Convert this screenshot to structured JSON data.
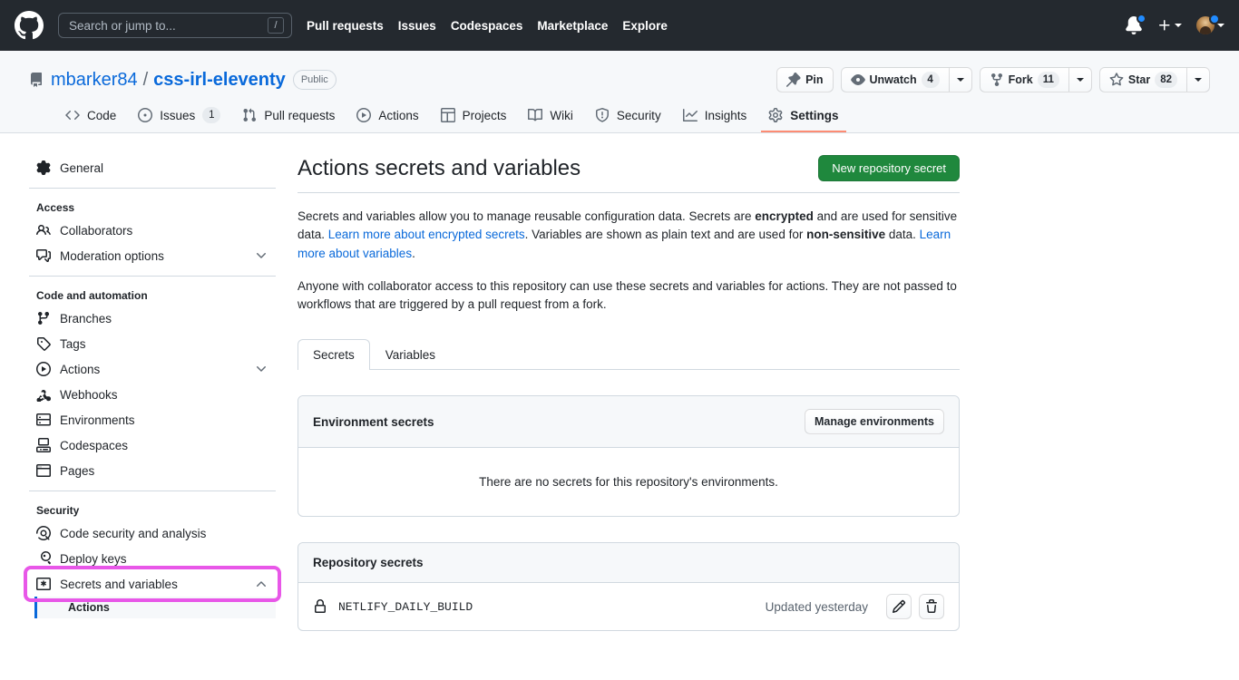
{
  "header": {
    "logo_icon": "github-mark-icon",
    "search": {
      "placeholder": "Search or jump to...",
      "shortcut": "/"
    },
    "nav": [
      {
        "label": "Pull requests"
      },
      {
        "label": "Issues"
      },
      {
        "label": "Codespaces"
      },
      {
        "label": "Marketplace"
      },
      {
        "label": "Explore"
      }
    ],
    "notifications_icon": "bell-icon",
    "create_new_icon": "plus-icon",
    "avatar_icon": "user-avatar"
  },
  "repo": {
    "icon": "repo-icon",
    "owner": "mbarker84",
    "separator": "/",
    "name": "css-irl-eleventy",
    "visibility": "Public",
    "actions": {
      "pin": {
        "label": "Pin",
        "icon": "pin-icon"
      },
      "watch": {
        "label": "Unwatch",
        "count": "4",
        "icon": "eye-icon"
      },
      "fork": {
        "label": "Fork",
        "count": "11",
        "icon": "fork-icon"
      },
      "star": {
        "label": "Star",
        "count": "82",
        "icon": "star-icon"
      }
    },
    "tabs": [
      {
        "label": "Code",
        "icon": "code-icon",
        "count": null,
        "active": false
      },
      {
        "label": "Issues",
        "icon": "issue-opened-icon",
        "count": "1",
        "active": false
      },
      {
        "label": "Pull requests",
        "icon": "git-pull-request-icon",
        "count": null,
        "active": false
      },
      {
        "label": "Actions",
        "icon": "play-icon",
        "count": null,
        "active": false
      },
      {
        "label": "Projects",
        "icon": "table-icon",
        "count": null,
        "active": false
      },
      {
        "label": "Wiki",
        "icon": "book-icon",
        "count": null,
        "active": false
      },
      {
        "label": "Security",
        "icon": "shield-icon",
        "count": null,
        "active": false
      },
      {
        "label": "Insights",
        "icon": "graph-icon",
        "count": null,
        "active": false
      },
      {
        "label": "Settings",
        "icon": "gear-icon",
        "count": null,
        "active": true
      }
    ]
  },
  "sidebar": {
    "general": {
      "label": "General",
      "icon": "gear-icon"
    },
    "sections": [
      {
        "title": "Access",
        "items": [
          {
            "label": "Collaborators",
            "icon": "people-icon",
            "expandable": false
          },
          {
            "label": "Moderation options",
            "icon": "comment-discussion-icon",
            "expandable": true,
            "expanded": false
          }
        ]
      },
      {
        "title": "Code and automation",
        "items": [
          {
            "label": "Branches",
            "icon": "git-branch-icon",
            "expandable": false
          },
          {
            "label": "Tags",
            "icon": "tag-icon",
            "expandable": false
          },
          {
            "label": "Actions",
            "icon": "play-icon",
            "expandable": true,
            "expanded": false
          },
          {
            "label": "Webhooks",
            "icon": "webhook-icon",
            "expandable": false
          },
          {
            "label": "Environments",
            "icon": "server-icon",
            "expandable": false
          },
          {
            "label": "Codespaces",
            "icon": "codespaces-icon",
            "expandable": false
          },
          {
            "label": "Pages",
            "icon": "browser-icon",
            "expandable": false
          }
        ]
      },
      {
        "title": "Security",
        "items": [
          {
            "label": "Code security and analysis",
            "icon": "codescan-icon",
            "expandable": false
          },
          {
            "label": "Deploy keys",
            "icon": "key-icon",
            "expandable": false
          },
          {
            "label": "Secrets and variables",
            "icon": "key-asterisk-icon",
            "expandable": true,
            "expanded": true,
            "highlighted": true
          }
        ]
      }
    ],
    "active_subitem": {
      "label": "Actions"
    },
    "highlight_color": "#e857e8",
    "active_indicator_color": "#0969da"
  },
  "main": {
    "title": "Actions secrets and variables",
    "new_secret_button": "New repository secret",
    "new_secret_button_color": "#1f883d",
    "description_1": {
      "part1": "Secrets and variables allow you to manage reusable configuration data. Secrets are ",
      "bold1": "encrypted",
      "part2": " and are used for sensitive data. ",
      "link1": "Learn more about encrypted secrets",
      "part3": ". Variables are shown as plain text and are used for ",
      "bold2": "non-sensitive",
      "part4": " data. ",
      "link2": "Learn more about variables",
      "part5": "."
    },
    "description_2": "Anyone with collaborator access to this repository can use these secrets and variables for actions. They are not passed to workflows that are triggered by a pull request from a fork.",
    "tabs": [
      {
        "label": "Secrets",
        "active": true
      },
      {
        "label": "Variables",
        "active": false
      }
    ],
    "environment_secrets": {
      "title": "Environment secrets",
      "manage_button": "Manage environments",
      "empty_message": "There are no secrets for this repository's environments."
    },
    "repository_secrets": {
      "title": "Repository secrets",
      "rows": [
        {
          "icon": "lock-icon",
          "name": "NETLIFY_DAILY_BUILD",
          "updated": "Updated yesterday",
          "edit_icon": "pencil-icon",
          "delete_icon": "trash-icon"
        }
      ]
    }
  }
}
